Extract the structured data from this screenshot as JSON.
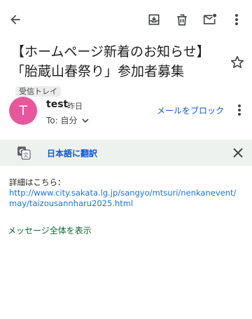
{
  "toolbar": {
    "back_icon": "arrow-left-icon",
    "archive_icon": "archive-icon",
    "delete_icon": "trash-icon",
    "mark_unread_icon": "mail-unread-icon",
    "more_icon": "more-vert-icon"
  },
  "message": {
    "subject": "【ホームページ新着のお知らせ】「胎蔵山春祭り」参加者募集",
    "label": "受信トレイ",
    "star_icon": "star-outline-icon"
  },
  "sender": {
    "avatar_letter": "T",
    "avatar_color": "#e8579b",
    "name": "test",
    "date": "昨日",
    "to_line": "To: 自分",
    "block_label": "メールをブロック"
  },
  "translate": {
    "label": "日本語に翻訳",
    "icon": "translate-icon",
    "close_icon": "close-icon"
  },
  "body": {
    "intro": "詳細はこちら：",
    "link": "http://www.city.sakata.lg.jp/sangyo/mtsuri/nenkanevent/may/taizousannharu2025.html"
  },
  "footer": {
    "show_all": "メッセージ全体を表示"
  },
  "colors": {
    "accent_blue": "#0b57d0",
    "link_blue": "#1a73e8",
    "show_all_green": "#0d652d",
    "translate_bar_bg": "#eef2ee"
  }
}
